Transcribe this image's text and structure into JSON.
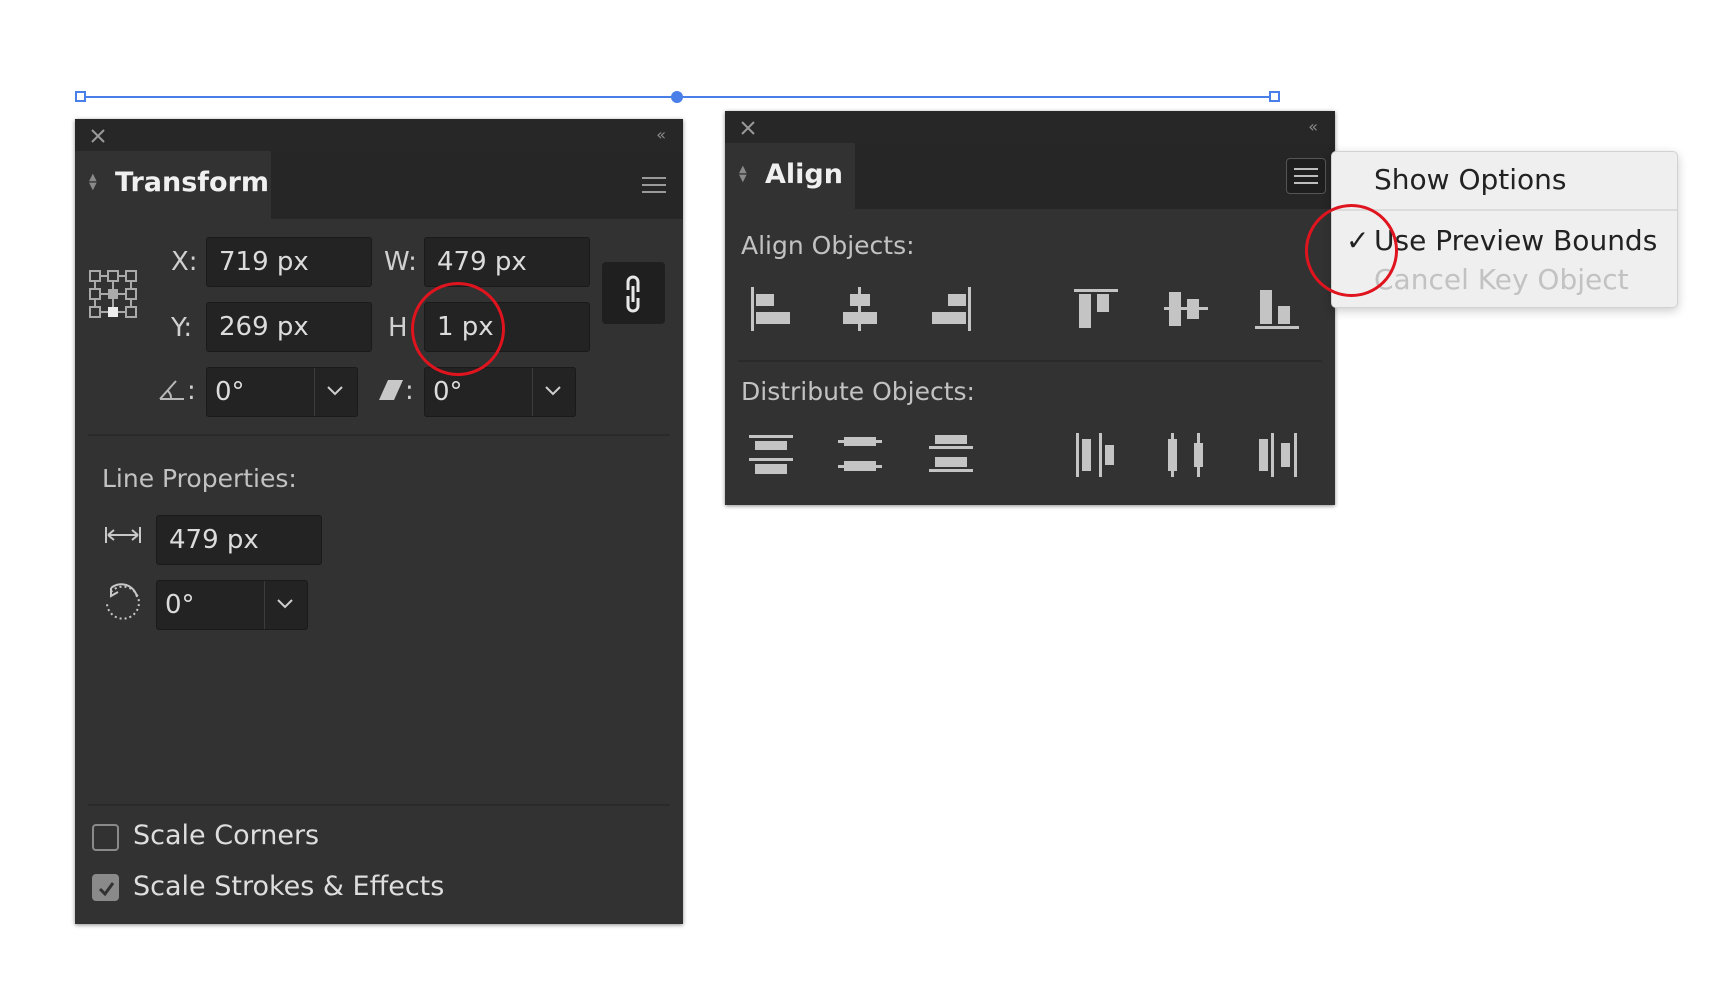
{
  "transform_panel": {
    "title": "Transform",
    "x_label": "X:",
    "x_value": "719 px",
    "y_label": "Y:",
    "y_value": "269 px",
    "w_label": "W:",
    "w_value": "479 px",
    "h_label": "H",
    "h_value": "1 px",
    "angle_sep": ":",
    "angle_value": "0°",
    "shear_sep": ":",
    "shear_value": "0°",
    "line_properties_label": "Line Properties:",
    "line_length_value": "479 px",
    "line_angle_value": "0°",
    "scale_corners_label": "Scale Corners",
    "scale_corners_checked": false,
    "scale_strokes_label": "Scale Strokes & Effects",
    "scale_strokes_checked": true
  },
  "align_panel": {
    "title": "Align",
    "align_objects_label": "Align Objects:",
    "distribute_objects_label": "Distribute Objects:",
    "align_buttons": [
      "horizontal-align-left",
      "horizontal-align-center",
      "horizontal-align-right",
      "vertical-align-top",
      "vertical-align-center",
      "vertical-align-bottom"
    ],
    "distribute_buttons": [
      "vertical-distribute-top",
      "vertical-distribute-center",
      "vertical-distribute-bottom",
      "horizontal-distribute-left",
      "horizontal-distribute-center",
      "horizontal-distribute-right"
    ]
  },
  "flyout_menu": {
    "show_options": "Show Options",
    "check_mark": "✓",
    "use_preview_bounds": "Use Preview Bounds",
    "use_preview_bounds_checked": true,
    "cancel_key_object": "Cancel Key Object",
    "cancel_key_object_enabled": false
  },
  "colors": {
    "panel_bg": "#323232",
    "selection": "#4a7ee8",
    "annotation": "#e0141e"
  }
}
